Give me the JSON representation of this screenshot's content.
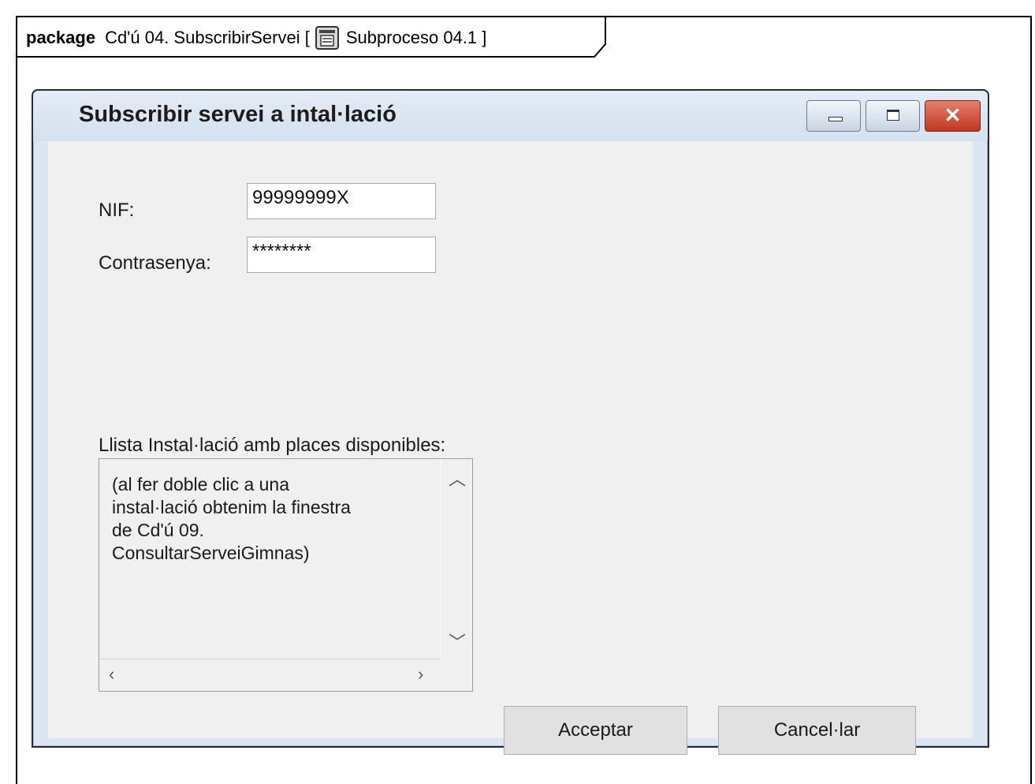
{
  "package": {
    "keyword": "package",
    "name": "Cd'ú 04. SubscribirServei [",
    "icon": "diagram-icon",
    "diagram": "Subproceso 04.1 ]"
  },
  "window": {
    "title": "Subscribir servei a intal·lació",
    "controls": {
      "minimize": "minimize-icon",
      "maximize": "maximize-icon",
      "close": "close-icon"
    }
  },
  "form": {
    "nif_label": "NIF:",
    "nif_value": "99999999X",
    "password_label": "Contrasenya:",
    "password_value": "********",
    "list_label": "Llista Instal·lació amb places disponibles:",
    "list_text": "(al fer doble clic a una\ninstal·lació obtenim la finestra\nde Cd'ú 09.\nConsultarServeiGimnas)"
  },
  "buttons": {
    "accept": "Acceptar",
    "cancel": "Cancel·lar"
  }
}
